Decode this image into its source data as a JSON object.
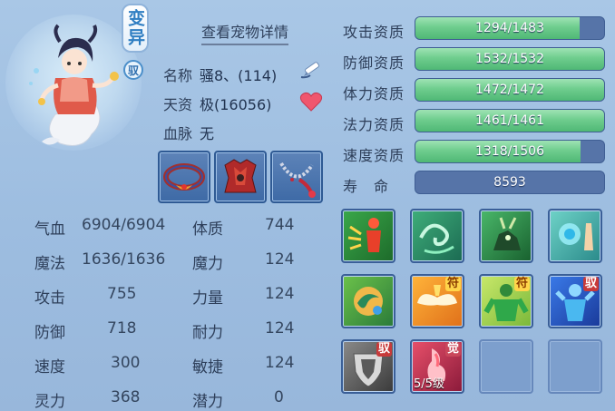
{
  "pet": {
    "badge_transform": "变异",
    "badge_mount": "驭",
    "view_details": "查看宠物详情",
    "name_label": "名称",
    "name_value": "骚8、(114)",
    "talent_label": "天资",
    "talent_value": "极(16056)",
    "bloodline_label": "血脉",
    "bloodline_value": "无"
  },
  "attributes": [
    {
      "label": "气血",
      "value": "6904/6904",
      "label2": "体质",
      "value2": "744"
    },
    {
      "label": "魔法",
      "value": "1636/1636",
      "label2": "魔力",
      "value2": "124"
    },
    {
      "label": "攻击",
      "value": "755",
      "label2": "力量",
      "value2": "124"
    },
    {
      "label": "防御",
      "value": "718",
      "label2": "耐力",
      "value2": "124"
    },
    {
      "label": "速度",
      "value": "300",
      "label2": "敏捷",
      "value2": "124"
    },
    {
      "label": "灵力",
      "value": "368",
      "label2": "潜力",
      "value2": "0"
    }
  ],
  "aptitudes": [
    {
      "label": "攻击资质",
      "text": "1294/1483",
      "current": 1294,
      "max": 1483
    },
    {
      "label": "防御资质",
      "text": "1532/1532",
      "current": 1532,
      "max": 1532
    },
    {
      "label": "体力资质",
      "text": "1472/1472",
      "current": 1472,
      "max": 1472
    },
    {
      "label": "法力资质",
      "text": "1461/1461",
      "current": 1461,
      "max": 1461
    },
    {
      "label": "速度资质",
      "text": "1318/1506",
      "current": 1318,
      "max": 1506
    }
  ],
  "lifespan": {
    "label": "寿　命",
    "value": "8593"
  },
  "skills": {
    "tag_fu": "符",
    "tag_yu": "驭",
    "tag_jue": "觉",
    "awaken_level": "5/5级"
  },
  "colors": {
    "bar_fill": "#6fcd8e",
    "bar_bg": "#5674a8",
    "accent_blue": "#2f7ec2"
  }
}
